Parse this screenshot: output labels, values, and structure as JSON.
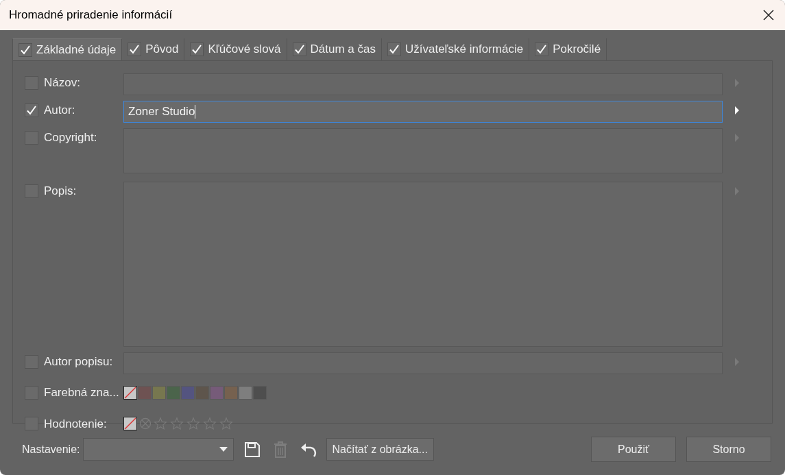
{
  "window": {
    "title": "Hromadné priradenie informácií"
  },
  "tabs": [
    {
      "label": "Základné údaje",
      "selected": true,
      "checked": true
    },
    {
      "label": "Pôvod",
      "selected": false,
      "checked": true
    },
    {
      "label": "Kľúčové slová",
      "selected": false,
      "checked": true
    },
    {
      "label": "Dátum a čas",
      "selected": false,
      "checked": true
    },
    {
      "label": "Užívateľské informácie",
      "selected": false,
      "checked": true
    },
    {
      "label": "Pokročilé",
      "selected": false,
      "checked": true
    }
  ],
  "fields": [
    {
      "kind": "single",
      "label": "Názov:",
      "checked": false,
      "focused": false
    },
    {
      "kind": "single",
      "label": "Autor:",
      "checked": true,
      "focused": true,
      "value": "Zoner Studio"
    },
    {
      "kind": "short-area",
      "label": "Copyright:",
      "checked": false,
      "focused": false
    },
    {
      "kind": "tall-area",
      "label": "Popis:",
      "checked": false,
      "focused": false
    },
    {
      "kind": "single",
      "label": "Autor popisu:",
      "checked": false,
      "focused": false
    }
  ],
  "color_label": {
    "label": "Farebná zna...",
    "checked": false,
    "swatches": [
      {
        "kind": "none",
        "selected": true
      },
      {
        "kind": "color",
        "color": "#6e5252",
        "selected": false
      },
      {
        "kind": "color",
        "color": "#77774f",
        "selected": false
      },
      {
        "kind": "color",
        "color": "#4b644b",
        "selected": false
      },
      {
        "kind": "color",
        "color": "#545480",
        "selected": false
      },
      {
        "kind": "color",
        "color": "#5e554c",
        "selected": false
      },
      {
        "kind": "color",
        "color": "#765b79",
        "selected": false
      },
      {
        "kind": "color",
        "color": "#76614f",
        "selected": false
      },
      {
        "kind": "color",
        "color": "#7e7e7e",
        "selected": false
      },
      {
        "kind": "color",
        "color": "#4e4e4e",
        "selected": false
      }
    ]
  },
  "rating": {
    "label": "Hodnotenie:",
    "checked": false,
    "stars": 0
  },
  "footer": {
    "preset_label": "Nastavenie:",
    "load_button": "Načítať z obrázka...",
    "apply_button": "Použiť",
    "cancel_button": "Storno"
  }
}
